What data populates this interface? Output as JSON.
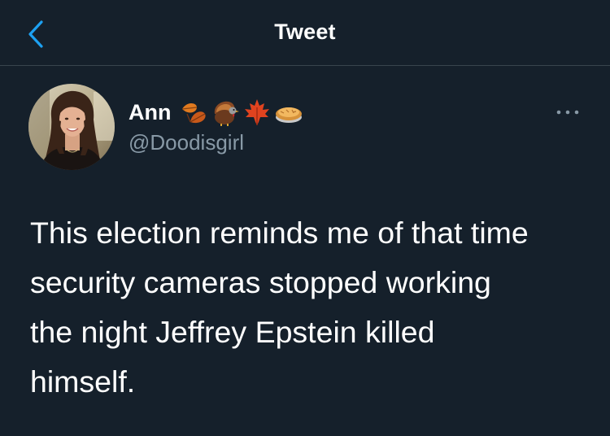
{
  "navbar": {
    "back_icon": "chevron-left-icon",
    "title": "Tweet"
  },
  "tweet": {
    "author": {
      "display_name": "Ann",
      "name_emojis": [
        "fallen-leaves-emoji",
        "turkey-emoji",
        "maple-leaf-emoji",
        "pie-emoji"
      ],
      "handle": "@Doodisgirl"
    },
    "more_icon": "more-horizontal-icon",
    "text": "This election reminds me of that time\nsecurity cameras stopped working\nthe night Jeffrey Epstein killed\nhimself."
  },
  "colors": {
    "background": "#15202b",
    "divider": "#38444d",
    "accent": "#1da1f2",
    "secondary_text": "#8899a6",
    "primary_text": "#ffffff"
  }
}
